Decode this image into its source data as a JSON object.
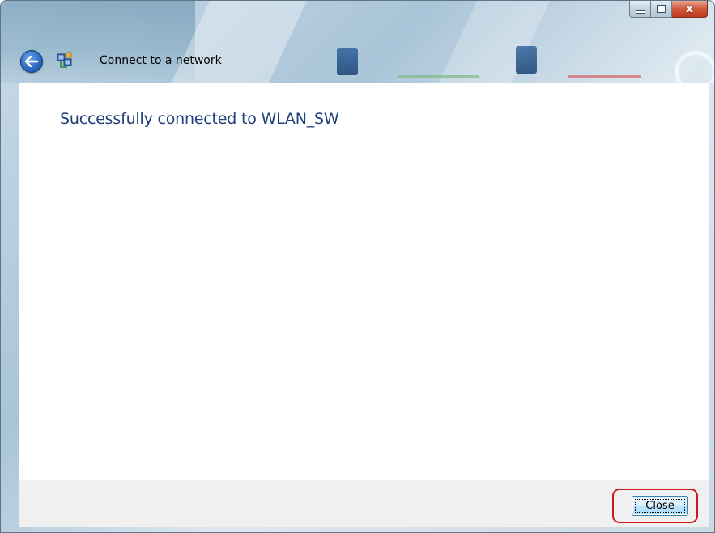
{
  "window": {
    "title": "Connect to a network",
    "caption_buttons": {
      "minimize_icon": "minimize-icon",
      "maximize_icon": "maximize-icon",
      "close_icon": "close-x-icon",
      "close_glyph": "x"
    },
    "back_icon": "back-arrow-icon",
    "title_icon": "network-icon"
  },
  "content": {
    "heading": "Successfully connected to WLAN_SW"
  },
  "footer": {
    "close_label": "Close",
    "close_label_access_key": "l"
  },
  "colors": {
    "heading": "#1f3f7a",
    "highlight": "#d01818",
    "close_button_border": "#3c7fb1",
    "footer_bg": "#f0f0f0"
  }
}
